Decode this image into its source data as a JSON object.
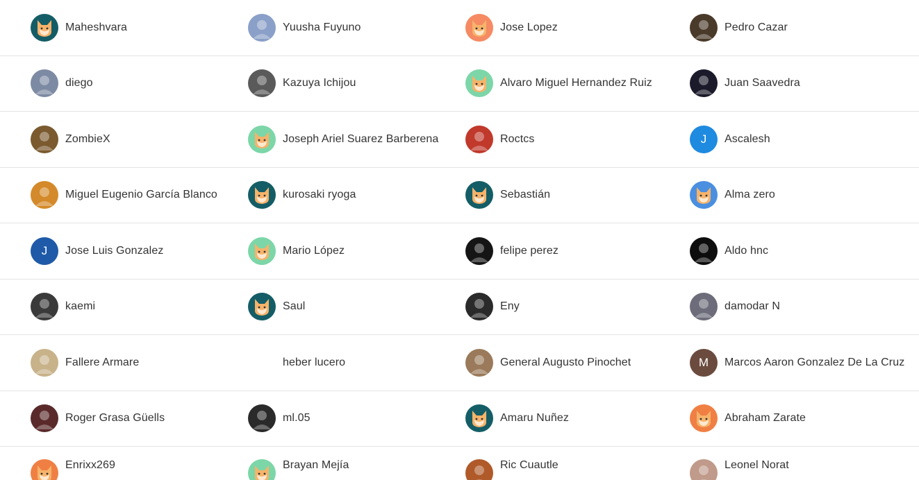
{
  "colors": {
    "fox_orange": "#f07f44",
    "teal": "#145d66",
    "mint": "#7cd6a8",
    "peach": "#f58a63",
    "sky": "#4a8fe0",
    "blue": "#1e8ae0",
    "navy": "#1e5aa8",
    "brown": "#6b4b3e"
  },
  "users": [
    {
      "name": "Maheshvara",
      "avatar": {
        "type": "fox",
        "bg": "#145d66",
        "icon": "fox-icon"
      }
    },
    {
      "name": "Yuusha Fuyuno",
      "avatar": {
        "type": "photo",
        "bg": "#8aa0c8",
        "icon": "photo-avatar"
      }
    },
    {
      "name": "Jose Lopez",
      "avatar": {
        "type": "fox",
        "bg": "#f58a63",
        "icon": "fox-icon"
      }
    },
    {
      "name": "Pedro Cazar",
      "avatar": {
        "type": "photo",
        "bg": "#4a3a2a",
        "icon": "photo-avatar"
      }
    },
    {
      "name": "diego",
      "avatar": {
        "type": "photo",
        "bg": "#7d8aa3",
        "icon": "photo-avatar"
      }
    },
    {
      "name": "Kazuya Ichijou",
      "avatar": {
        "type": "photo",
        "bg": "#5a5a5a",
        "icon": "photo-avatar"
      }
    },
    {
      "name": "Alvaro Miguel Hernandez Ruiz",
      "avatar": {
        "type": "fox",
        "bg": "#7cd6a8",
        "icon": "fox-icon"
      }
    },
    {
      "name": "Juan Saavedra",
      "avatar": {
        "type": "photo",
        "bg": "#1a1a2a",
        "icon": "photo-avatar"
      }
    },
    {
      "name": "ZombieX",
      "avatar": {
        "type": "photo",
        "bg": "#7a5a2e",
        "icon": "photo-avatar"
      }
    },
    {
      "name": "Joseph Ariel Suarez Barberena",
      "avatar": {
        "type": "fox",
        "bg": "#7cd6a8",
        "icon": "fox-icon"
      }
    },
    {
      "name": "Roctcs",
      "avatar": {
        "type": "photo",
        "bg": "#c0392b",
        "icon": "photo-avatar"
      }
    },
    {
      "name": "Ascalesh",
      "avatar": {
        "type": "letter",
        "bg": "#1e8ae0",
        "letter": "J"
      }
    },
    {
      "name": "Miguel Eugenio García Blanco",
      "avatar": {
        "type": "photo",
        "bg": "#d48a2a",
        "icon": "photo-avatar"
      }
    },
    {
      "name": "kurosaki ryoga",
      "avatar": {
        "type": "fox",
        "bg": "#145d66",
        "icon": "fox-icon"
      }
    },
    {
      "name": "Sebastián",
      "avatar": {
        "type": "fox",
        "bg": "#145d66",
        "icon": "fox-icon"
      }
    },
    {
      "name": "Alma zero",
      "avatar": {
        "type": "fox",
        "bg": "#4a8fe0",
        "icon": "fox-icon"
      }
    },
    {
      "name": "Jose Luis Gonzalez",
      "avatar": {
        "type": "letter",
        "bg": "#1e5aa8",
        "letter": "J"
      }
    },
    {
      "name": "Mario López",
      "avatar": {
        "type": "fox",
        "bg": "#7cd6a8",
        "icon": "fox-icon"
      }
    },
    {
      "name": "felipe perez",
      "avatar": {
        "type": "photo",
        "bg": "#151515",
        "icon": "photo-avatar"
      }
    },
    {
      "name": "Aldo hnc",
      "avatar": {
        "type": "photo",
        "bg": "#0d0d0d",
        "icon": "photo-avatar"
      }
    },
    {
      "name": "kaemi",
      "avatar": {
        "type": "photo",
        "bg": "#3a3a3a",
        "icon": "photo-avatar"
      }
    },
    {
      "name": "Saul",
      "avatar": {
        "type": "fox",
        "bg": "#145d66",
        "icon": "fox-icon"
      }
    },
    {
      "name": "Eny",
      "avatar": {
        "type": "photo",
        "bg": "#2a2a2a",
        "icon": "photo-avatar"
      }
    },
    {
      "name": "damodar N",
      "avatar": {
        "type": "photo",
        "bg": "#6c6c7a",
        "icon": "photo-avatar"
      }
    },
    {
      "name": "Fallere Armare",
      "avatar": {
        "type": "photo",
        "bg": "#c8b28a",
        "icon": "photo-avatar"
      }
    },
    {
      "name": "heber lucero",
      "avatar": {
        "type": "photo",
        "bg": "#ffffff",
        "icon": "photo-avatar"
      }
    },
    {
      "name": "General Augusto Pinochet",
      "avatar": {
        "type": "photo",
        "bg": "#9a7a5a",
        "icon": "photo-avatar"
      }
    },
    {
      "name": "Marcos Aaron Gonzalez De La Cruz",
      "avatar": {
        "type": "letter",
        "bg": "#6b4b3e",
        "letter": "M"
      }
    },
    {
      "name": "Roger Grasa Güells",
      "avatar": {
        "type": "photo",
        "bg": "#5a2a2a",
        "icon": "photo-avatar"
      }
    },
    {
      "name": "ml.05",
      "avatar": {
        "type": "photo",
        "bg": "#2a2a2a",
        "icon": "photo-avatar"
      }
    },
    {
      "name": "Amaru Nuñez",
      "avatar": {
        "type": "fox",
        "bg": "#145d66",
        "icon": "fox-icon"
      }
    },
    {
      "name": "Abraham Zarate",
      "avatar": {
        "type": "fox",
        "bg": "#f07f44",
        "icon": "fox-icon"
      }
    },
    {
      "name": "Enrixx269",
      "avatar": {
        "type": "fox",
        "bg": "#f07f44",
        "icon": "fox-icon"
      }
    },
    {
      "name": "Brayan Mejía",
      "avatar": {
        "type": "fox",
        "bg": "#7cd6a8",
        "icon": "fox-icon"
      }
    },
    {
      "name": "Ric Cuautle",
      "avatar": {
        "type": "photo",
        "bg": "#b05a2a",
        "icon": "photo-avatar"
      }
    },
    {
      "name": "Leonel Norat",
      "avatar": {
        "type": "photo",
        "bg": "#c09a8a",
        "icon": "photo-avatar"
      }
    }
  ]
}
